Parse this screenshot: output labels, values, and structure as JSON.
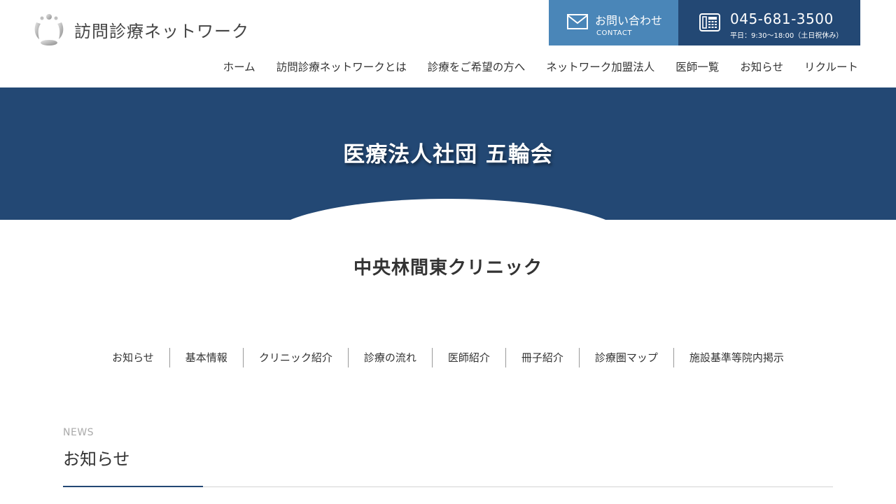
{
  "header": {
    "logo_text": "訪問診療ネットワーク",
    "contact": {
      "label": "お問い合わせ",
      "sub": "CONTACT"
    },
    "tel": {
      "number": "045-681-3500",
      "hours": "平日：9:30〜18:00（土日祝休み）"
    }
  },
  "gnav": {
    "items": [
      {
        "label": "ホーム"
      },
      {
        "label": "訪問診療ネットワークとは"
      },
      {
        "label": "診療をご希望の方へ"
      },
      {
        "label": "ネットワーク加盟法人"
      },
      {
        "label": "医師一覧"
      },
      {
        "label": "お知らせ"
      },
      {
        "label": "リクルート"
      }
    ]
  },
  "hero": {
    "title": "医療法人社団 五輪会"
  },
  "clinic": {
    "title": "中央林間東クリニック"
  },
  "subnav": {
    "items": [
      {
        "label": "お知らせ"
      },
      {
        "label": "基本情報"
      },
      {
        "label": "クリニック紹介"
      },
      {
        "label": "診療の流れ"
      },
      {
        "label": "医師紹介"
      },
      {
        "label": "冊子紹介"
      },
      {
        "label": "診療圏マップ"
      },
      {
        "label": "施設基準等院内掲示"
      }
    ]
  },
  "news": {
    "label_en": "NEWS",
    "title": "お知らせ"
  },
  "colors": {
    "navy": "#234874",
    "blue": "#4a86b8"
  },
  "icons": {
    "contact": "mail-icon",
    "tel": "phone-icon",
    "logo": "logo-mark-icon"
  }
}
